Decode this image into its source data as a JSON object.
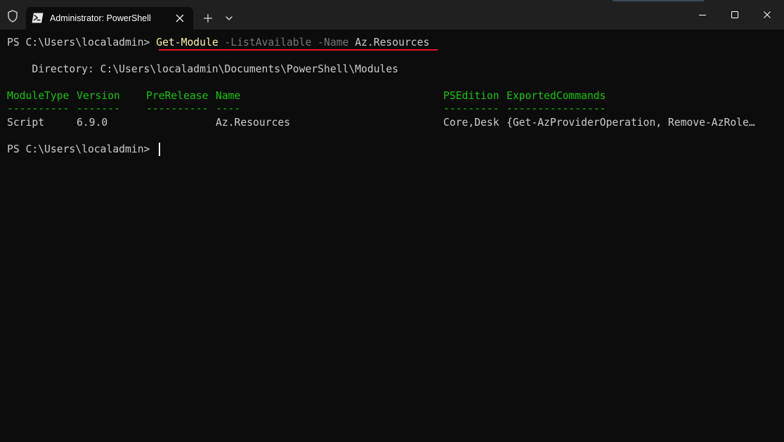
{
  "tab": {
    "title": "Administrator: PowerShell"
  },
  "terminal": {
    "prompt": "PS C:\\Users\\localadmin> ",
    "command": {
      "cmdlet": "Get-Module",
      "param1": " -ListAvailable",
      "param2": " -Name",
      "value": " Az.Resources"
    },
    "directory_line": "    Directory: C:\\Users\\localadmin\\Documents\\PowerShell\\Modules",
    "table": {
      "headers": [
        "ModuleType",
        "Version",
        "PreRelease",
        "Name",
        "PSEdition",
        "ExportedCommands"
      ],
      "separators": [
        "----------",
        "-------",
        "----------",
        "----",
        "---------",
        "----------------"
      ],
      "rows": [
        [
          "Script",
          "6.9.0",
          "",
          "Az.Resources",
          "Core,Desk",
          "{Get-AzProviderOperation, Remove-AzRole…"
        ]
      ]
    },
    "final_prompt": "PS C:\\Users\\localadmin> "
  },
  "colors": {
    "background": "#0c0c0c",
    "titlebar": "#202020",
    "cmdlet": "#f9f1a5",
    "parameter": "#767676",
    "header": "#16c60c",
    "underline": "#e81123"
  },
  "icons": {
    "shield": "shield-icon",
    "powershell": "powershell-icon",
    "close_tab": "close-icon",
    "new_tab": "plus-icon",
    "dropdown": "chevron-down-icon",
    "minimize": "minimize-icon",
    "maximize": "maximize-icon",
    "close_window": "close-icon"
  }
}
